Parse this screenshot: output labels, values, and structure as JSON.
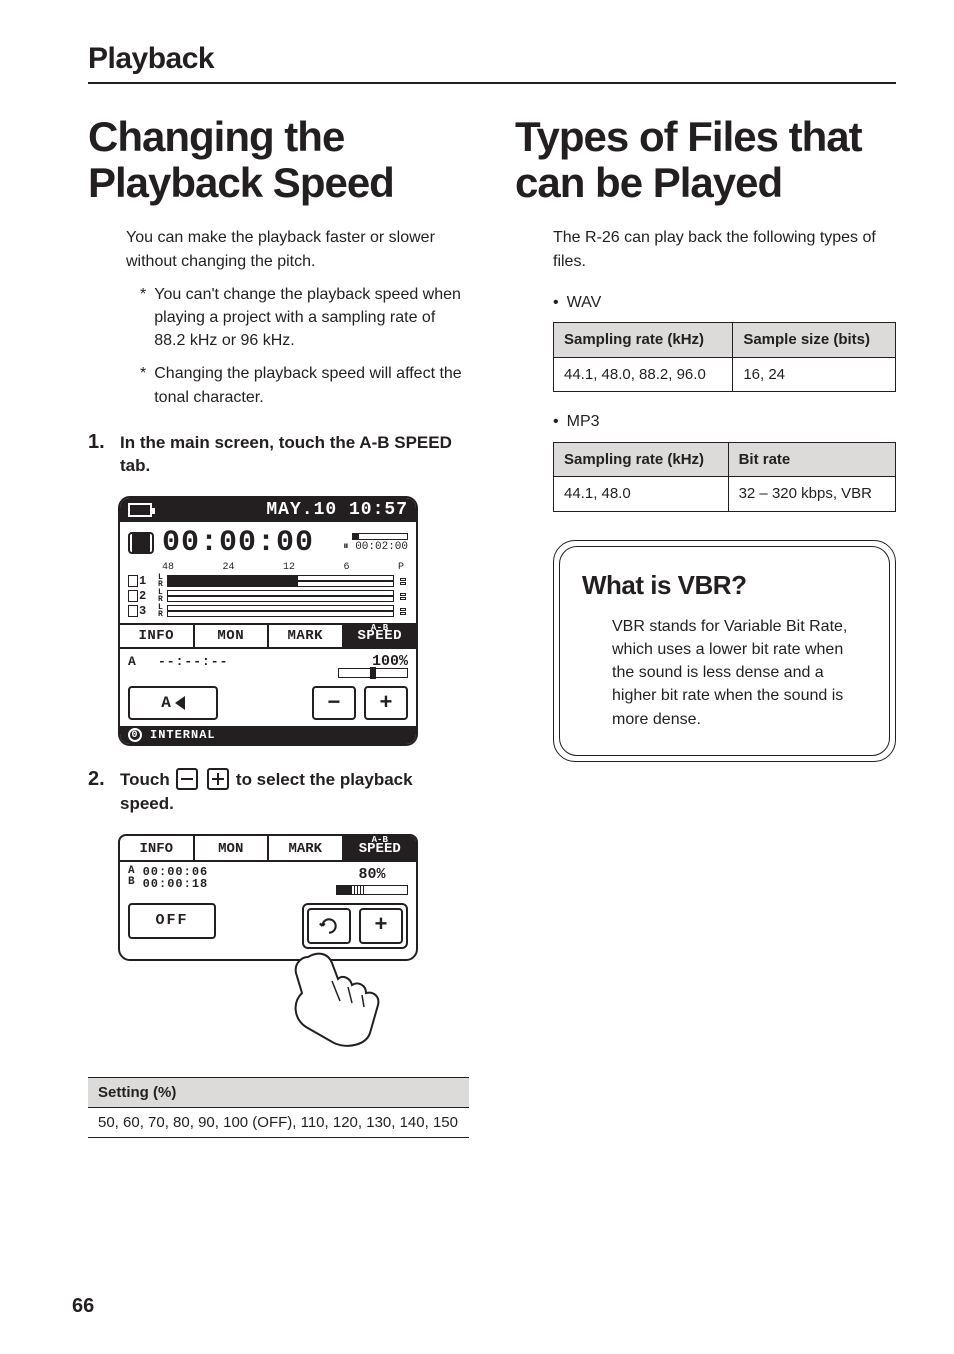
{
  "section_title": "Playback",
  "page_number": "66",
  "left": {
    "heading": "Changing the Playback Speed",
    "intro": "You can make the playback faster or slower without changing the pitch.",
    "notes": [
      "You can't change the playback speed when playing a project with a sampling rate of 88.2 kHz or 96 kHz.",
      "Changing the playback speed will affect the tonal character."
    ],
    "step1": "In the main screen, touch the A-B SPEED tab.",
    "step2_pre": "Touch ",
    "step2_post": " to select the playback speed.",
    "setting_header": "Setting (%)",
    "setting_values": "50, 60, 70, 80, 90, 100 (OFF), 110, 120, 130, 140, 150",
    "lcd1": {
      "datetime": "MAY.10 10:57",
      "bigtime": "00:00:00",
      "subtime_icon": "⏸",
      "subtime": "00:02:00",
      "scale": [
        "48",
        "24",
        "12",
        "6",
        "P"
      ],
      "tabs": [
        "INFO",
        "MON",
        "MARK"
      ],
      "tab_active_line1": "A-B",
      "tab_active_line2": "SPEED",
      "a_label": "A",
      "dashes": "--:--:--",
      "percent": "100%",
      "btn_a": "A",
      "storage_idx": "0",
      "storage": "INTERNAL"
    },
    "lcd2": {
      "tabs": [
        "INFO",
        "MON",
        "MARK"
      ],
      "tab_active_line1": "A-B",
      "tab_active_line2": "SPEED",
      "ab_a": "A",
      "ab_b": "B",
      "time_a": "00:00:06",
      "time_b": "00:00:18",
      "percent": "80%",
      "off": "OFF"
    }
  },
  "right": {
    "heading": "Types of Files that can be Played",
    "intro": "The R-26 can play back the following types of files.",
    "bullet_wav": "WAV",
    "bullet_mp3": "MP3",
    "wav_table": {
      "h1": "Sampling rate (kHz)",
      "h2": "Sample size (bits)",
      "c1": "44.1, 48.0, 88.2, 96.0",
      "c2": "16, 24"
    },
    "mp3_table": {
      "h1": "Sampling rate (kHz)",
      "h2": "Bit rate",
      "c1": "44.1, 48.0",
      "c2": "32 – 320 kbps, VBR"
    },
    "callout": {
      "title": "What is VBR?",
      "body": "VBR stands for Variable Bit Rate, which uses a lower bit rate when the sound is less dense and a higher bit rate when the sound is more dense."
    }
  }
}
